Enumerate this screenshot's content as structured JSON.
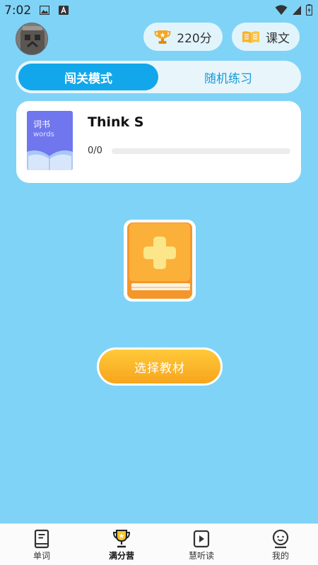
{
  "status_bar": {
    "time": "7:02"
  },
  "header": {
    "score": "220分",
    "text_button": "课文"
  },
  "tabs": [
    {
      "label": "闯关模式",
      "active": true
    },
    {
      "label": "随机练习",
      "active": false
    }
  ],
  "book": {
    "cover_title": "词书",
    "cover_subtitle": "words",
    "title": "Think S",
    "progress_text": "0/0",
    "progress": 0
  },
  "select_button": "选择教材",
  "nav": [
    {
      "label": "单词",
      "icon": "book-icon",
      "active": false
    },
    {
      "label": "满分营",
      "icon": "trophy-icon",
      "active": true
    },
    {
      "label": "慧听读",
      "icon": "play-icon",
      "active": false
    },
    {
      "label": "我的",
      "icon": "profile-icon",
      "active": false
    }
  ],
  "colors": {
    "background": "#7fd3f7",
    "accent": "#12a7ea",
    "button_gold": "#f7a51d",
    "cover": "#6f76ee"
  }
}
